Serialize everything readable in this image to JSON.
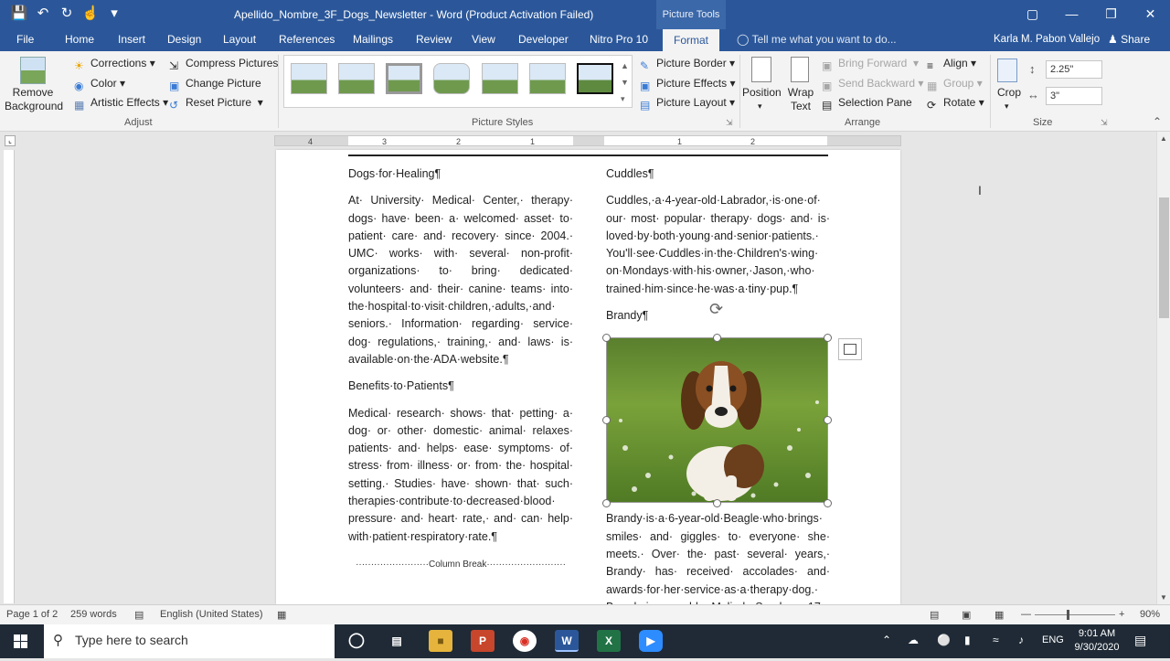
{
  "titlebar": {
    "title": "Apellido_Nombre_3F_Dogs_Newsletter - Word (Product Activation Failed)",
    "context_tab": "Picture Tools"
  },
  "tabs": [
    "File",
    "Home",
    "Insert",
    "Design",
    "Layout",
    "References",
    "Mailings",
    "Review",
    "View",
    "Developer",
    "Nitro Pro 10"
  ],
  "active_tab": "Format",
  "tellme_placeholder": "Tell me what you want to do...",
  "user_name": "Karla M. Pabon Vallejo",
  "share_label": "Share",
  "ribbon": {
    "adjust": {
      "remove_background": "Remove Background",
      "corrections": "Corrections",
      "color": "Color",
      "artistic_effects": "Artistic Effects",
      "compress": "Compress Pictures",
      "change": "Change Picture",
      "reset": "Reset Picture",
      "label": "Adjust"
    },
    "styles": {
      "label": "Picture Styles",
      "border": "Picture Border",
      "effects": "Picture Effects",
      "layout": "Picture Layout"
    },
    "arrange": {
      "position": "Position",
      "wrap": "Wrap Text",
      "bring_forward": "Bring Forward",
      "send_backward": "Send Backward",
      "selection_pane": "Selection Pane",
      "align": "Align",
      "group": "Group",
      "rotate": "Rotate",
      "label": "Arrange"
    },
    "size": {
      "crop": "Crop",
      "height": "2.25\"",
      "width": "3\"",
      "label": "Size"
    }
  },
  "ruler_numbers": [
    "4",
    "3",
    "2",
    "1",
    "1",
    "2"
  ],
  "document": {
    "left": {
      "h1": "Dogs·for·Healing¶",
      "p1": "At· University· Medical· Center,· therapy· dogs· have· been· a· welcomed· asset· to· patient· care· and· recovery· since· 2004.· UMC· works· with· several· non-profit· organizations· to· bring· dedicated· volunteers· and· their· canine· teams· into· the·hospital·to·visit·children,·adults,·and· seniors.· Information· regarding· service· dog· regulations,· training,· and· laws· is· available·on·the·ADA·website.¶",
      "h2": "Benefits·to·Patients¶",
      "p2": "Medical· research· shows· that· petting· a· dog· or· other· domestic· animal· relaxes· patients· and· helps· ease· symptoms· of· stress· from· illness· or· from· the· hospital· setting.· Studies· have· shown· that· such· therapies·contribute·to·decreased·blood· pressure· and· heart· rate,· and· can· help· with·patient·respiratory·rate.¶",
      "column_break": "Column Break"
    },
    "right": {
      "h1": "Cuddles¶",
      "p1": "Cuddles,·a·4-year-old·Labrador,·is·one·of· our· most· popular· therapy· dogs· and· is· loved·by·both·young·and·senior·patients.· You'll·see·Cuddles·in·the·Children's·wing· on·Mondays·with·his·owner,·Jason,·who· trained·him·since·he·was·a·tiny·pup.¶",
      "h2": "Brandy¶",
      "p2": "Brandy·is·a·6-year-old·Beagle·who·brings· smiles· and· giggles· to· everyone· she· meets.· Over· the· past· several· years,· Brandy· has· received· accolades· and· awards·for·her·service·as·a·therapy·dog.· Brandy·is·owned·by·Melinda·Sparks,·a·17-"
    }
  },
  "statusbar": {
    "page": "Page 1 of 2",
    "words": "259 words",
    "language": "English (United States)",
    "zoom": "90%"
  },
  "taskbar": {
    "search_placeholder": "Type here to search",
    "lang": "ENG",
    "time": "9:01 AM",
    "date": "9/30/2020"
  },
  "colors": {
    "word_blue": "#2b579a"
  }
}
